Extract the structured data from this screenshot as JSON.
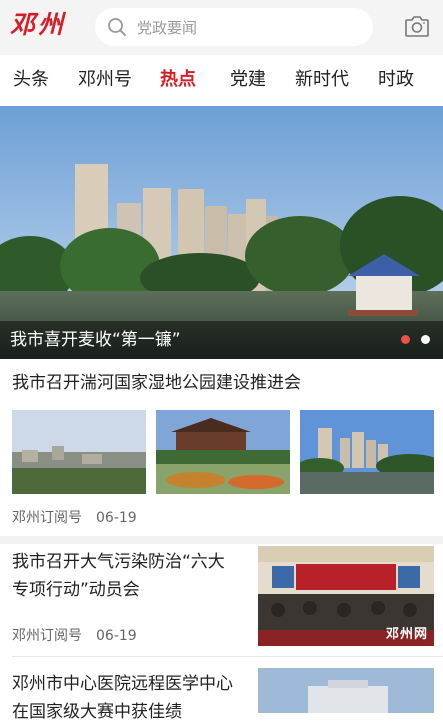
{
  "header": {
    "logo": "邓州",
    "search_placeholder": "党政要闻",
    "search_icon": "search-icon",
    "camera_icon": "camera-icon"
  },
  "tabs": [
    {
      "label": "头条"
    },
    {
      "label": "邓州号"
    },
    {
      "label": "热点",
      "active": true
    },
    {
      "label": "党建"
    },
    {
      "label": "新时代"
    },
    {
      "label": "时政"
    }
  ],
  "banner": {
    "caption": "我市喜开麦收“第一镰”",
    "dots": 2,
    "active_dot": 0
  },
  "articles": [
    {
      "title": "我市召开湍河国家湿地公园建设推进会",
      "source": "邓州订阅号",
      "date": "06-19"
    },
    {
      "title_lines": [
        "我市召开大气污染防治“六大",
        "专项行动”动员会"
      ],
      "source": "邓州订阅号",
      "date": "06-19",
      "thumb_watermark": "邓州网"
    },
    {
      "title_lines": [
        "邓州市中心医院远程医学中心",
        "在国家级大赛中获佳绩"
      ]
    }
  ],
  "colors": {
    "accent": "#d41f26",
    "divider": "#f2f2f2"
  }
}
